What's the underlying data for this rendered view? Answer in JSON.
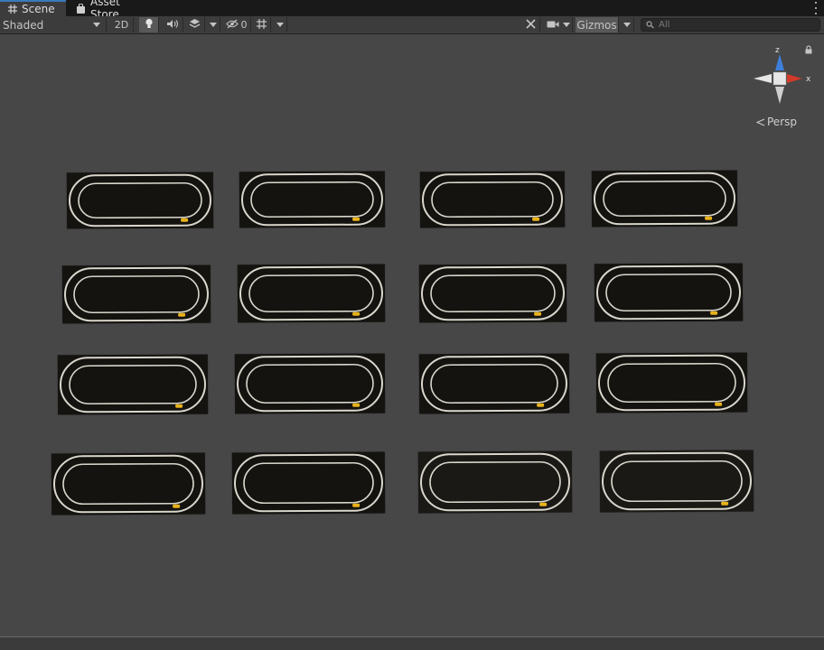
{
  "tabs": [
    {
      "label": "Scene",
      "icon": "grid-hash-icon",
      "active": true
    },
    {
      "label": "Asset Store",
      "icon": "bag-icon",
      "active": false
    }
  ],
  "toolbar": {
    "shading_mode": "Shaded",
    "toggle_2d": "2D",
    "hidden_count": "0",
    "gizmos_label": "Gizmos",
    "search_placeholder": "All"
  },
  "gizmo": {
    "axis_z": "z",
    "axis_x": "x",
    "projection": "Persp"
  },
  "scene": {
    "object_type": "race-track tile",
    "grid_rows": 4,
    "grid_columns": 4,
    "tile_count": 16
  },
  "colors": {
    "viewport_bg": "#474747",
    "axis_x": "#d23a2a",
    "axis_z": "#3d7fd9",
    "tab_accent": "#3a79bb",
    "track_line": "#d9d6cc",
    "track_mark": "#e8b21a"
  }
}
